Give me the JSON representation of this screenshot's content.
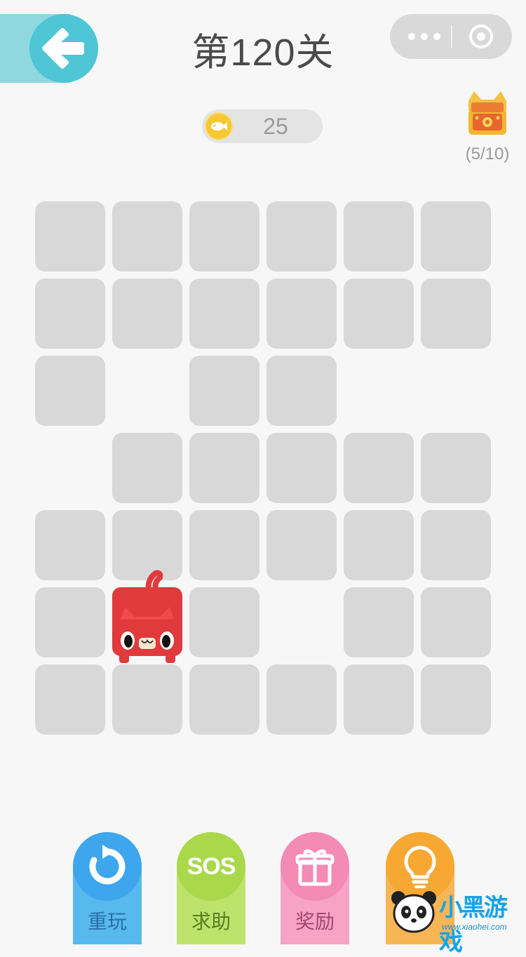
{
  "header": {
    "title": "第120关",
    "back_icon": "back-arrow-icon",
    "menu_icon": "more-dots-icon",
    "close_icon": "target-circle-icon"
  },
  "coins": {
    "icon": "fish-coin-icon",
    "count": "25"
  },
  "chest": {
    "icon": "treasure-chest-icon",
    "progress": "(5/10)"
  },
  "board": {
    "rows": 7,
    "cols": 6,
    "cells": [
      [
        1,
        1,
        1,
        1,
        1,
        1
      ],
      [
        1,
        1,
        1,
        1,
        1,
        1
      ],
      [
        1,
        0,
        1,
        1,
        0,
        0
      ],
      [
        0,
        1,
        1,
        1,
        1,
        1
      ],
      [
        1,
        1,
        1,
        1,
        1,
        1
      ],
      [
        1,
        2,
        1,
        0,
        1,
        1
      ],
      [
        1,
        1,
        1,
        1,
        1,
        1
      ]
    ],
    "legend": {
      "0": "empty",
      "1": "unvisited-tile",
      "2": "cat"
    },
    "cat": {
      "row": 5,
      "col": 1,
      "color": "#e03a3c"
    },
    "tile_color": "#d8d8d8"
  },
  "actions": [
    {
      "id": "restart",
      "label": "重玩",
      "icon": "restart-icon",
      "color": "#3da6ec",
      "label_color": "#2a6fa8"
    },
    {
      "id": "sos",
      "label": "求助",
      "icon": "sos-icon",
      "icon_text": "SOS",
      "color": "#a9d94a",
      "label_color": "#5a7d1f"
    },
    {
      "id": "reward",
      "label": "奖励",
      "icon": "gift-icon",
      "color": "#f38bb4",
      "label_color": "#a8466f"
    },
    {
      "id": "hint",
      "label": "",
      "icon": "lightbulb-icon",
      "color": "#f6a833",
      "label_color": "#9a6010"
    }
  ],
  "watermark": {
    "text": "小黑游戏",
    "sub": "www.xiaohei.com",
    "icon": "panda-logo-icon"
  }
}
